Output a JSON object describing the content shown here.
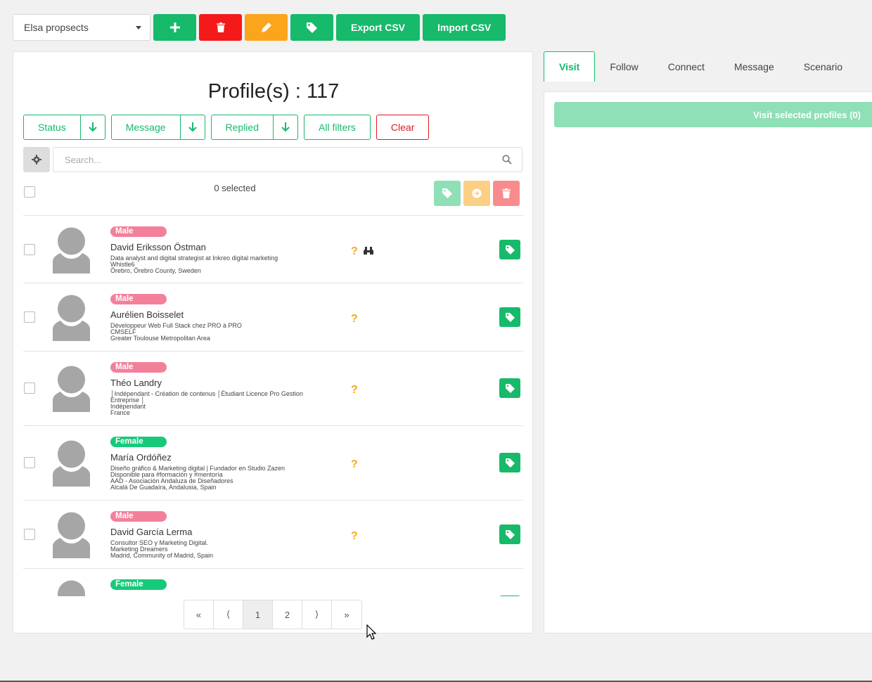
{
  "toolbar": {
    "list_select": "Elsa propsects",
    "add_icon": "plus-icon",
    "delete_icon": "trash-icon",
    "edit_icon": "pencil-icon",
    "tag_icon": "tag-icon",
    "export_label": "Export CSV",
    "import_label": "Import CSV"
  },
  "profiles": {
    "title": "Profile(s) : 117",
    "filters": {
      "status": "Status",
      "message": "Message",
      "replied": "Replied",
      "all_filters": "All filters",
      "clear": "Clear"
    },
    "search_placeholder": "Search...",
    "selected_text": "0 selected",
    "rows": [
      {
        "gender": "Male",
        "name": "David Eriksson Östman",
        "lines": [
          "Data analyst and digital strategist at Inkreo digital marketing",
          "Whistle6",
          "Örebro, Örebro County, Sweden"
        ],
        "status_icons": [
          "question-icon",
          "binoculars-icon"
        ]
      },
      {
        "gender": "Male",
        "name": "Aurélien Boisselet",
        "lines": [
          "Développeur Web Full Stack chez PRO à PRO",
          "CMSELF",
          "Greater Toulouse Metropolitan Area"
        ],
        "status_icons": [
          "question-icon"
        ]
      },
      {
        "gender": "Male",
        "name": "Théo Landry",
        "lines": [
          "│Indépendant - Création de contenus  │Étudiant Licence Pro Gestion",
          "Entreprise  │",
          "Indépendant",
          "France"
        ],
        "status_icons": [
          "question-icon"
        ]
      },
      {
        "gender": "Female",
        "name": "María Ordóñez",
        "lines": [
          "Diseño gráfico & Marketing digital | Fundador en Studio Zazen",
          "Disponible para #formación y #mentoría",
          "AAD - Asociación Andaluza de Diseñadores",
          "Alcalá De Guadaíra, Andalusia, Spain"
        ],
        "status_icons": [
          "question-icon"
        ]
      },
      {
        "gender": "Male",
        "name": "David García Lerma",
        "lines": [
          "Consultor SEO y Marketing Digital.",
          "Marketing Dreamers",
          "Madrid, Community of Madrid, Spain"
        ],
        "status_icons": [
          "question-icon"
        ]
      },
      {
        "gender": "Female",
        "name": "",
        "lines": [],
        "status_icons": []
      }
    ],
    "pagination": {
      "first": "«",
      "prev": "⟨",
      "page1": "1",
      "page2": "2",
      "next": "⟩",
      "last": "»"
    }
  },
  "tabs": [
    "Visit",
    "Follow",
    "Connect",
    "Message",
    "Scenario"
  ],
  "visit_button": "Visit selected profiles (0)",
  "colors": {
    "accent": "#17b96b",
    "danger": "#f51a1a",
    "warning": "#fba51c",
    "male": "#f3809b",
    "female": "#17c979"
  }
}
